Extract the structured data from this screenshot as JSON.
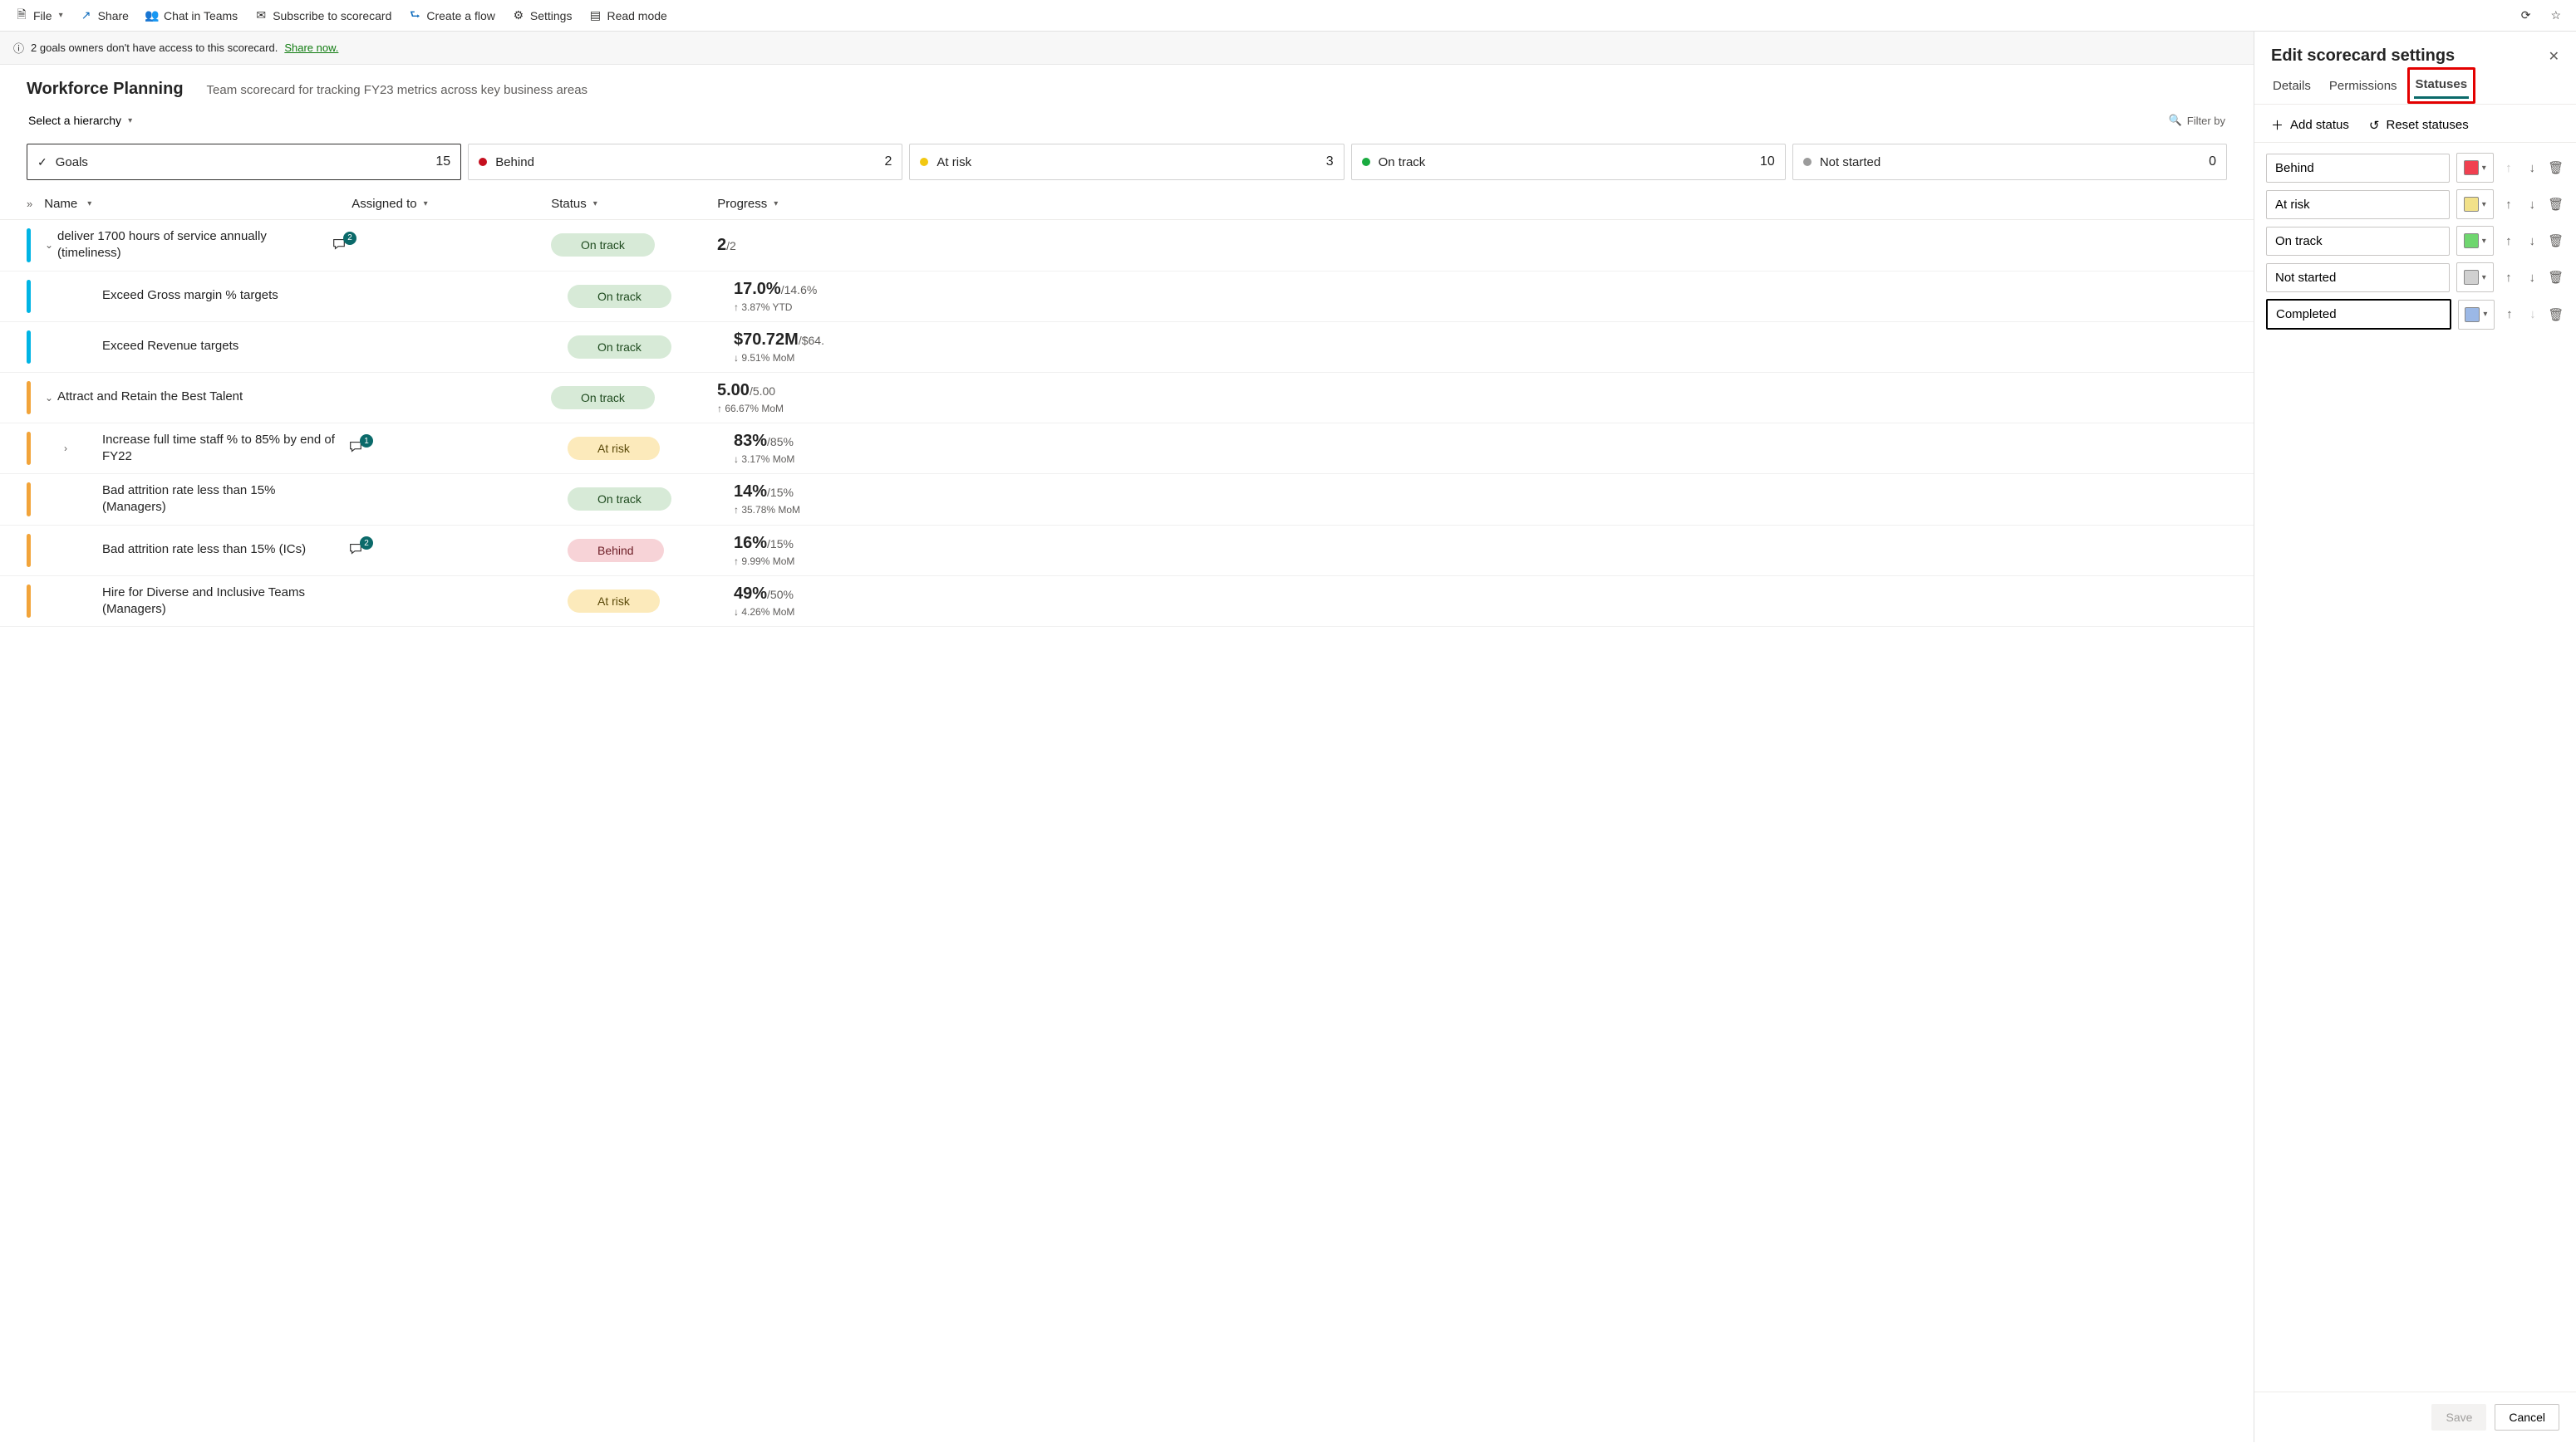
{
  "toolbar": {
    "file": "File",
    "share": "Share",
    "chat": "Chat in Teams",
    "subscribe": "Subscribe to scorecard",
    "createflow": "Create a flow",
    "settings": "Settings",
    "readmode": "Read mode"
  },
  "banner": {
    "text": "2 goals owners don't have access to this scorecard.",
    "link": "Share now."
  },
  "header": {
    "title": "Workforce Planning",
    "subtitle": "Team scorecard for tracking FY23 metrics across key business areas",
    "hierarchy": "Select a hierarchy",
    "filter": "Filter by"
  },
  "cards": [
    {
      "label": "Goals",
      "count": "15",
      "kind": "check",
      "active": true
    },
    {
      "label": "Behind",
      "count": "2",
      "color": "#c50f1f"
    },
    {
      "label": "At risk",
      "count": "3",
      "color": "#f2c811"
    },
    {
      "label": "On track",
      "count": "10",
      "color": "#1aab40"
    },
    {
      "label": "Not started",
      "count": "0",
      "color": "#9b9b9b"
    }
  ],
  "columns": {
    "name": "Name",
    "assigned": "Assigned to",
    "status": "Status",
    "progress": "Progress"
  },
  "rows": [
    {
      "bar": "teal",
      "indent": 0,
      "expand": "down",
      "name": "deliver 1700 hours of service annually (timeliness)",
      "comments": "2",
      "status": "On track",
      "pill": "ontrack",
      "prog": "2",
      "suffix": "/2",
      "delta": ""
    },
    {
      "bar": "teal",
      "indent": 1,
      "name": "Exceed Gross margin % targets",
      "status": "On track",
      "pill": "ontrack",
      "prog": "17.0%",
      "suffix": "/14.6%",
      "delta": "↑ 3.87% YTD"
    },
    {
      "bar": "teal",
      "indent": 1,
      "name": "Exceed Revenue targets",
      "status": "On track",
      "pill": "ontrack",
      "prog": "$70.72M",
      "suffix": "/$64.",
      "delta": "↓ 9.51% MoM"
    },
    {
      "bar": "orange",
      "indent": 0,
      "expand": "down",
      "name": "Attract and Retain the Best Talent",
      "status": "On track",
      "pill": "ontrack",
      "prog": "5.00",
      "suffix": "/5.00",
      "delta": "↑ 66.67% MoM"
    },
    {
      "bar": "orange",
      "indent": 1,
      "expand": "right",
      "name": "Increase full time staff % to 85% by end of FY22",
      "comments": "1",
      "status": "At risk",
      "pill": "atrisk",
      "prog": "83%",
      "suffix": "/85%",
      "delta": "↓ 3.17% MoM"
    },
    {
      "bar": "orange",
      "indent": 1,
      "name": "Bad attrition rate less than 15% (Managers)",
      "status": "On track",
      "pill": "ontrack",
      "prog": "14%",
      "suffix": "/15%",
      "delta": "↑ 35.78% MoM"
    },
    {
      "bar": "orange",
      "indent": 1,
      "name": "Bad attrition rate less than 15% (ICs)",
      "comments": "2",
      "status": "Behind",
      "pill": "behind",
      "prog": "16%",
      "suffix": "/15%",
      "delta": "↑ 9.99% MoM"
    },
    {
      "bar": "orange",
      "indent": 1,
      "name": "Hire for Diverse and Inclusive Teams (Managers)",
      "status": "At risk",
      "pill": "atrisk",
      "prog": "49%",
      "suffix": "/50%",
      "delta": "↓ 4.26% MoM"
    }
  ],
  "panel": {
    "title": "Edit scorecard settings",
    "tabs": {
      "details": "Details",
      "permissions": "Permissions",
      "statuses": "Statuses"
    },
    "actions": {
      "add": "Add status",
      "reset": "Reset statuses"
    },
    "statuses": [
      {
        "name": "Behind",
        "color": "#f04050"
      },
      {
        "name": "At risk",
        "color": "#f2e189"
      },
      {
        "name": "On track",
        "color": "#6fd66f"
      },
      {
        "name": "Not started",
        "color": "#d0d0d0"
      },
      {
        "name": "Completed",
        "color": "#9bb8e6",
        "editing": true
      }
    ],
    "save": "Save",
    "cancel": "Cancel"
  }
}
